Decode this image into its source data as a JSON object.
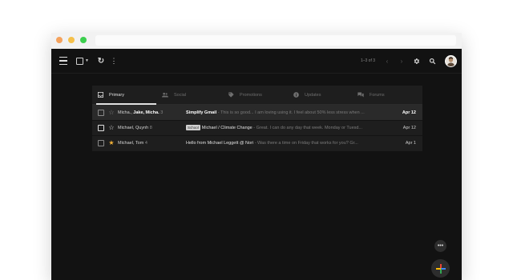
{
  "toolbar": {
    "range_text": "1–3 of 3"
  },
  "tabs": [
    {
      "label": "Primary",
      "icon": "inbox-icon"
    },
    {
      "label": "Social",
      "icon": "people-icon"
    },
    {
      "label": "Promotions",
      "icon": "tag-icon"
    },
    {
      "label": "Updates",
      "icon": "info-icon"
    },
    {
      "label": "Forums",
      "icon": "forum-icon"
    }
  ],
  "emails": [
    {
      "sender_prefix": "Micha.,",
      "sender_bold": "Jake, Micha.",
      "count": "3",
      "label": "",
      "subject": "Simplify Gmail",
      "snippet": "- This is so good... I am loving using it. I feel about 50% less stress when ...",
      "date": "Apr 12",
      "starred": false,
      "unread": true
    },
    {
      "sender": "Michael, Quynh",
      "count": "8",
      "label": "School",
      "subject": "Michael / Climate Change",
      "snippet": "- Great. I can do any day that week. Monday or Tuesd...",
      "date": "Apr 12",
      "starred": false,
      "unread": false
    },
    {
      "sender": "Michael, Tom",
      "count": "4",
      "label": "",
      "subject": "Hello from Michael Leggett @ Nori",
      "snippet": "- Was there a time on Friday that works for you? Gr...",
      "date": "Apr 1",
      "starred": true,
      "unread": false
    }
  ],
  "colors": {
    "star_active": "#f5b338",
    "background": "#121212",
    "card": "#1e1e1e"
  }
}
